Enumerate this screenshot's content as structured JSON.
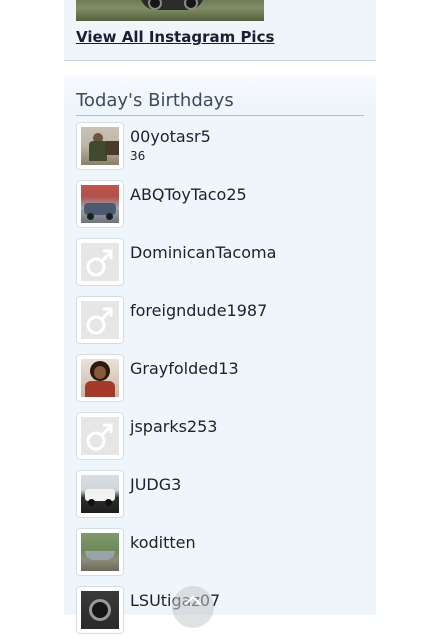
{
  "instagram": {
    "link_label": "View All Instagram Pics"
  },
  "birthdays": {
    "title": "Today's Birthdays",
    "members": [
      {
        "username": "00yotasr5",
        "age": "36",
        "avatar": "photo-person-with-truck"
      },
      {
        "username": "ABQToyTaco25",
        "avatar": "photo-blue-truck"
      },
      {
        "username": "DominicanTacoma",
        "avatar": "default-male-icon"
      },
      {
        "username": "foreigndude1987",
        "avatar": "default-male-icon"
      },
      {
        "username": "Grayfolded13",
        "avatar": "photo-person-portrait"
      },
      {
        "username": "jsparks253",
        "avatar": "default-male-icon"
      },
      {
        "username": "JUDG3",
        "avatar": "photo-white-truck"
      },
      {
        "username": "koditten",
        "avatar": "photo-boat"
      },
      {
        "username": "LSUtigaz07",
        "avatar": "photo-truck-wheel"
      }
    ]
  },
  "colors": {
    "panel_bg": "#eef5fb",
    "title_text": "#3e4b5c",
    "rule": "#a8c1d8",
    "default_avatar_bg": "#e6e6e6"
  }
}
